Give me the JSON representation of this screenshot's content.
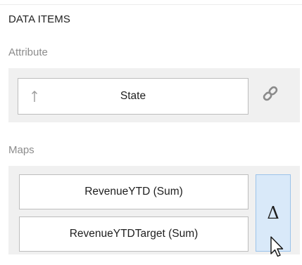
{
  "section_title": "DATA ITEMS",
  "attribute_group": {
    "label": "Attribute",
    "item": {
      "label": "State",
      "arrow_icon": "arrow-up-icon"
    },
    "link_icon": "chain-link-icon"
  },
  "maps_group": {
    "label": "Maps",
    "items": [
      {
        "label": "RevenueYTD (Sum)"
      },
      {
        "label": "RevenueYTDTarget (Sum)"
      }
    ],
    "delta_label": "Δ"
  },
  "colors": {
    "group_background": "#f0f0f0",
    "delta_background": "#d9e9f9",
    "delta_border": "#9cc3ea",
    "label_gray": "#8c8c8c"
  }
}
